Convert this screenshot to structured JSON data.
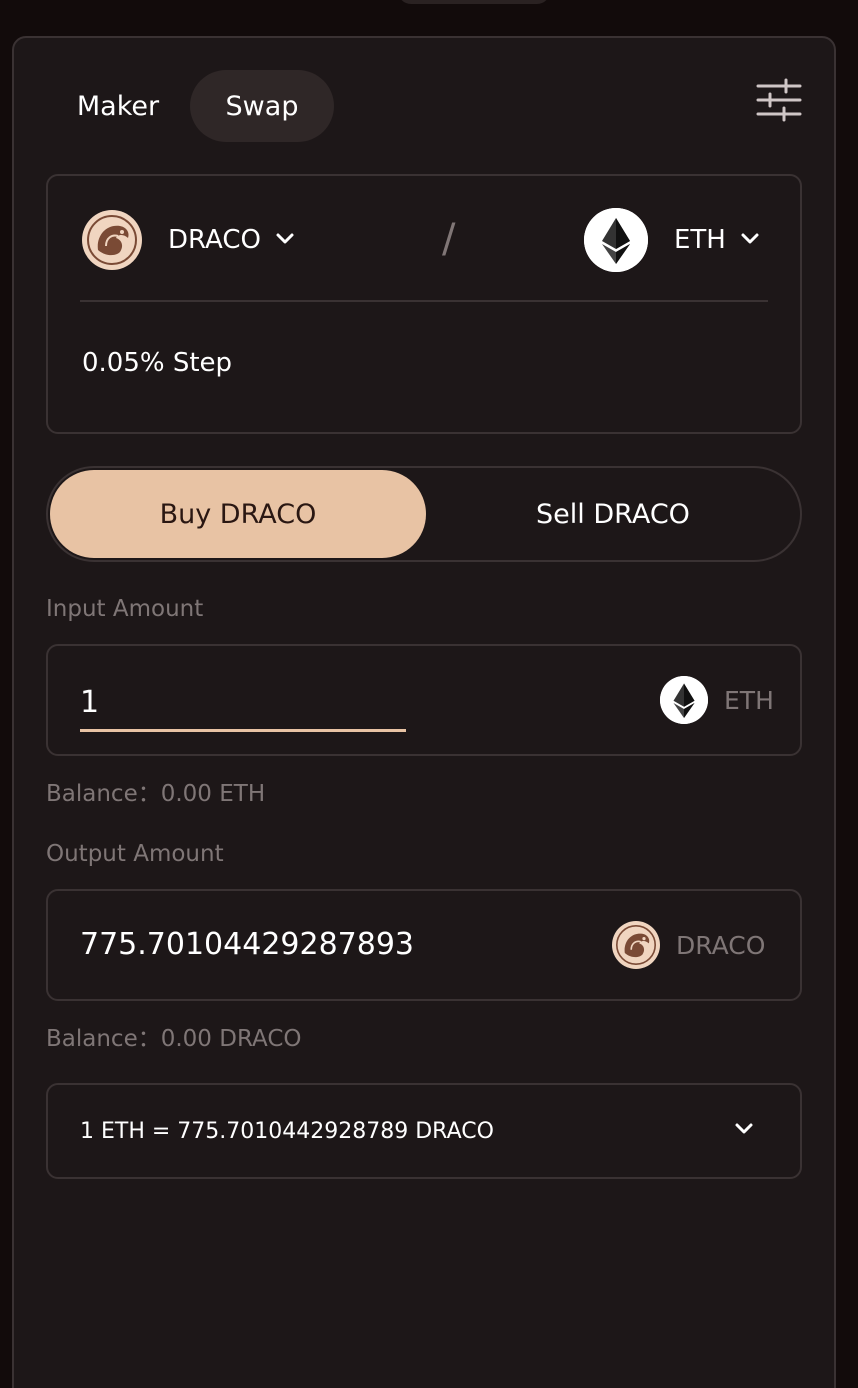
{
  "tabs": [
    {
      "label": "Maker"
    },
    {
      "label": "Swap"
    }
  ],
  "pair": {
    "token_a": "DRACO",
    "separator": "/",
    "token_b": "ETH",
    "step": "0.05% Step"
  },
  "side": {
    "buy_label": "Buy DRACO",
    "sell_label": "Sell DRACO"
  },
  "input": {
    "label": "Input Amount",
    "value": "1",
    "unit": "ETH",
    "balance": "Balance：0.00 ETH"
  },
  "output": {
    "label": "Output Amount",
    "value": "775.70104429287893",
    "unit": "DRACO",
    "balance": "Balance：0.00 DRACO"
  },
  "rate": {
    "text": "1 ETH = 775.7010442928789 DRACO"
  },
  "colors": {
    "accent": "#e8c3a4",
    "card_bg": "#1d1718",
    "page_bg": "#120b0b",
    "border": "#3a3233"
  },
  "icons": [
    "sliders-icon",
    "dragon-logo-icon",
    "ethereum-logo-icon",
    "chevron-down-icon"
  ]
}
